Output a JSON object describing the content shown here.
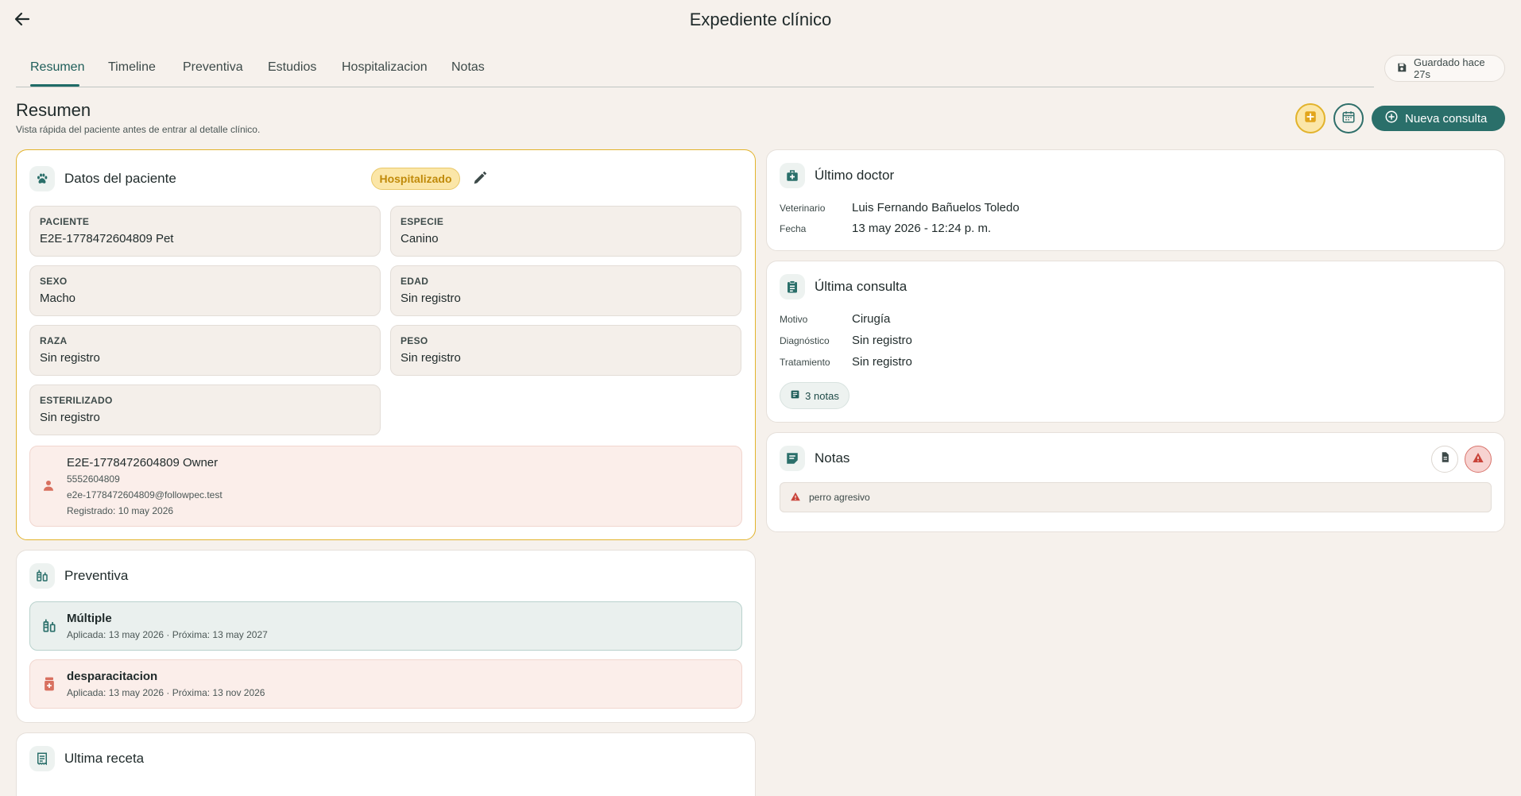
{
  "app": {
    "title": "Expediente clínico"
  },
  "tabs": [
    {
      "label": "Resumen",
      "active": true
    },
    {
      "label": "Timeline"
    },
    {
      "label": "Preventiva"
    },
    {
      "label": "Estudios"
    },
    {
      "label": "Hospitalizacion"
    },
    {
      "label": "Notas"
    }
  ],
  "save_status": "Guardado hace 27s",
  "section": {
    "title": "Resumen",
    "subtitle": "Vista rápida del paciente antes de entrar al detalle clínico."
  },
  "actions": {
    "new_consult": "Nueva consulta"
  },
  "patient": {
    "title": "Datos del paciente",
    "status_badge": "Hospitalizado",
    "fields": [
      {
        "label": "PACIENTE",
        "value": "E2E-1778472604809 Pet"
      },
      {
        "label": "ESPECIE",
        "value": "Canino"
      },
      {
        "label": "SEXO",
        "value": "Macho"
      },
      {
        "label": "EDAD",
        "value": "Sin registro"
      },
      {
        "label": "RAZA",
        "value": "Sin registro"
      },
      {
        "label": "PESO",
        "value": "Sin registro"
      },
      {
        "label": "ESTERILIZADO",
        "value": "Sin registro"
      }
    ],
    "owner": {
      "name": "E2E-1778472604809 Owner",
      "phone": "5552604809",
      "email": "e2e-1778472604809@followpec.test",
      "registered": "Registrado: 10 may 2026"
    }
  },
  "preventive": {
    "title": "Preventiva",
    "items": [
      {
        "name": "Múltiple",
        "meta": "Aplicada: 13 may 2026 · Próxima: 13 may 2027"
      },
      {
        "name": "desparacitacion",
        "meta": "Aplicada: 13 may 2026 · Próxima: 13 nov 2026"
      }
    ]
  },
  "prescription": {
    "title": "Ultima receta"
  },
  "last_doctor": {
    "title": "Último doctor",
    "rows": [
      {
        "key": "Veterinario",
        "value": "Luis Fernando Bañuelos Toledo"
      },
      {
        "key": "Fecha",
        "value": "13 may 2026 - 12:24 p. m."
      }
    ]
  },
  "last_consult": {
    "title": "Última consulta",
    "rows": [
      {
        "key": "Motivo",
        "value": "Cirugía"
      },
      {
        "key": "Diagnóstico",
        "value": "Sin registro"
      },
      {
        "key": "Tratamiento",
        "value": "Sin registro"
      }
    ],
    "notes_chip": "3 notas"
  },
  "notes": {
    "title": "Notas",
    "items": [
      {
        "text": "perro agresivo"
      }
    ]
  },
  "colors": {
    "accent": "#2a6f6a",
    "warning": "#e2b32c",
    "danger": "#d9534f",
    "background": "#f6f1ec"
  }
}
